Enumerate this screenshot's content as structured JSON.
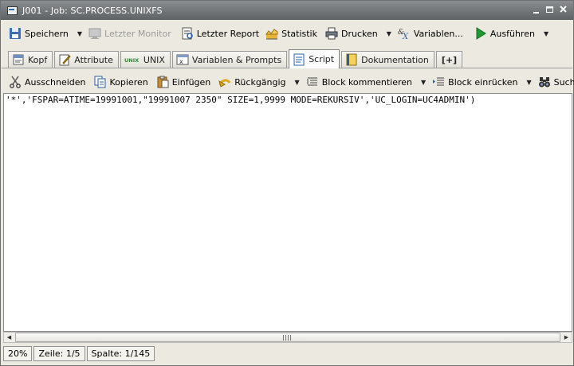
{
  "window": {
    "title": "J001 - Job: SC.PROCESS.UNIXFS"
  },
  "toolbar": {
    "items": [
      {
        "label": "Speichern",
        "icon": "save-icon",
        "dropdown": true
      },
      {
        "label": "Letzter Monitor",
        "icon": "monitor-icon",
        "disabled": true
      },
      {
        "label": "Letzter Report",
        "icon": "report-icon"
      },
      {
        "label": "Statistik",
        "icon": "statistics-icon"
      },
      {
        "label": "Drucken",
        "icon": "print-icon",
        "dropdown": true
      },
      {
        "label": "Variablen...",
        "icon": "variables-icon"
      },
      {
        "label": "Ausführen",
        "icon": "run-icon",
        "dropdown": true
      }
    ]
  },
  "tabs": [
    {
      "label": "Kopf",
      "icon": "header-icon"
    },
    {
      "label": "Attribute",
      "icon": "attribute-icon"
    },
    {
      "label": "UNIX",
      "icon": "unix-icon"
    },
    {
      "label": "Variablen & Prompts",
      "icon": "variables-prompts-icon"
    },
    {
      "label": "Script",
      "icon": "script-icon",
      "active": true
    },
    {
      "label": "Dokumentation",
      "icon": "documentation-icon"
    },
    {
      "label": "[+]",
      "icon": "add-tab-icon"
    }
  ],
  "script_toolbar": {
    "items": [
      {
        "label": "Ausschneiden",
        "icon": "cut-icon"
      },
      {
        "label": "Kopieren",
        "icon": "copy-icon"
      },
      {
        "label": "Einfügen",
        "icon": "paste-icon"
      },
      {
        "label": "Rückgängig",
        "icon": "undo-icon",
        "dropdown": true
      },
      {
        "label": "Block kommentieren",
        "icon": "comment-block-icon",
        "dropdown": true
      },
      {
        "label": "Block einrücken",
        "icon": "indent-block-icon",
        "dropdown": true
      },
      {
        "label": "Suche...",
        "icon": "binoculars-icon"
      }
    ]
  },
  "editor": {
    "line": "'*','FSPAR=ATIME=19991001,\"19991007 2350\" SIZE=1,9999 MODE=REKURSIV','UC_LOGIN=UC4ADMIN')"
  },
  "status": {
    "zoom": "20%",
    "line": "Zeile: 1/5",
    "column": "Spalte: 1/145"
  },
  "colors": {
    "titlebar": "#6b6e71",
    "run_green": "#1f9a2e",
    "disabled_text": "#9a9a9a"
  }
}
